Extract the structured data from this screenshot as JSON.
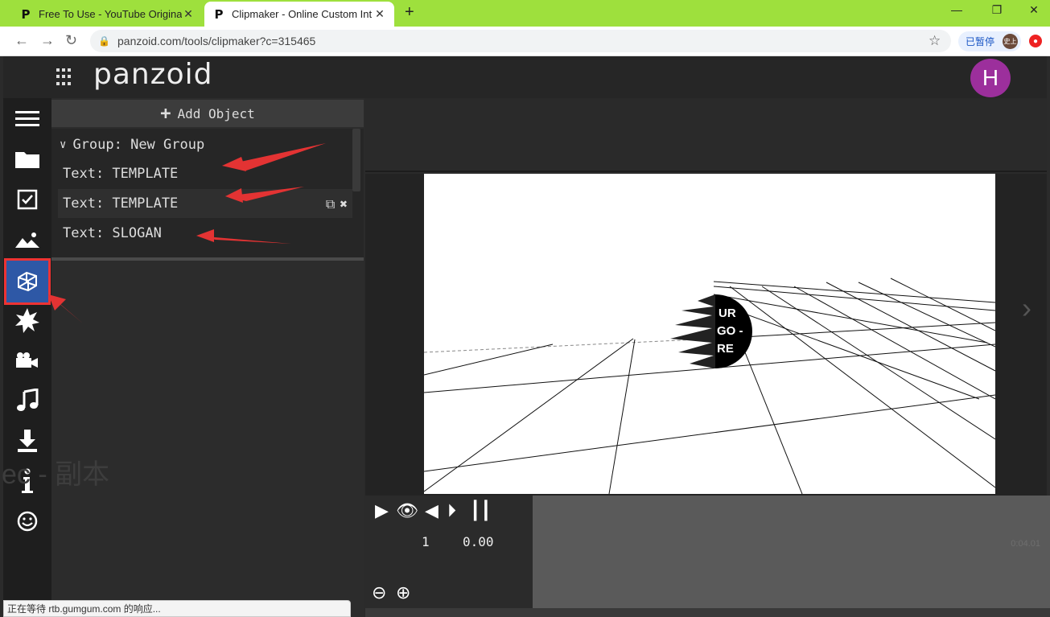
{
  "browser": {
    "tabs": [
      {
        "title": "Free To Use - YouTube Original",
        "favicon": "P"
      },
      {
        "title": "Clipmaker - Online Custom Int",
        "favicon": "P"
      }
    ],
    "new_tab": "+",
    "window_controls": {
      "minimize": "—",
      "restore": "❐",
      "close": "✕"
    },
    "url": "panzoid.com/tools/clipmaker?c=315465",
    "paused_label": "已暂停",
    "profile_initials": "史上"
  },
  "app": {
    "logo": "panzoid",
    "user_initial": "H"
  },
  "rail": {
    "items": [
      "menu-icon",
      "folder-icon",
      "checkbox-icon",
      "image-icon",
      "3d-object-icon",
      "particles-icon",
      "camera-icon",
      "music-icon",
      "download-icon",
      "info-icon",
      "smiley-icon"
    ],
    "selected": "3d-object-icon"
  },
  "objects": {
    "add_label": "Add Object",
    "group_label": "Group: New Group",
    "items": [
      {
        "label": "Text: TEMPLATE"
      },
      {
        "label": "Text: TEMPLATE"
      },
      {
        "label": "Text: SLOGAN"
      }
    ],
    "ghost_text": "ec - 副本"
  },
  "transport": {
    "frame": "1",
    "time": "0.00",
    "timeline_end": "0:04.01"
  },
  "status": {
    "text": "正在等待 rtb.gumgum.com 的响应..."
  },
  "colors": {
    "tab_strip": "#9ee03d",
    "selected_rail": "#2e58a6",
    "annotation_red": "#e33333",
    "avatar": "#9c2f9c"
  }
}
